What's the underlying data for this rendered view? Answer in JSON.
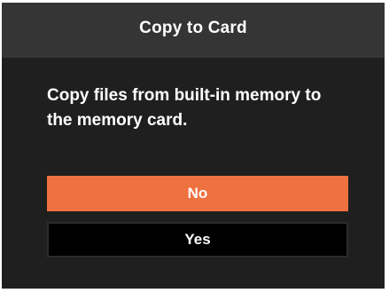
{
  "dialog": {
    "title": "Copy to Card",
    "message": "Copy files from built-in memory to the memory card.",
    "buttons": {
      "no_label": "No",
      "yes_label": "Yes"
    }
  },
  "colors": {
    "header_bg": "#353535",
    "body_bg": "#1f1f1f",
    "selected_button": "#ee7140",
    "unselected_button": "#000000",
    "text": "#ffffff"
  },
  "selected_button": "No"
}
